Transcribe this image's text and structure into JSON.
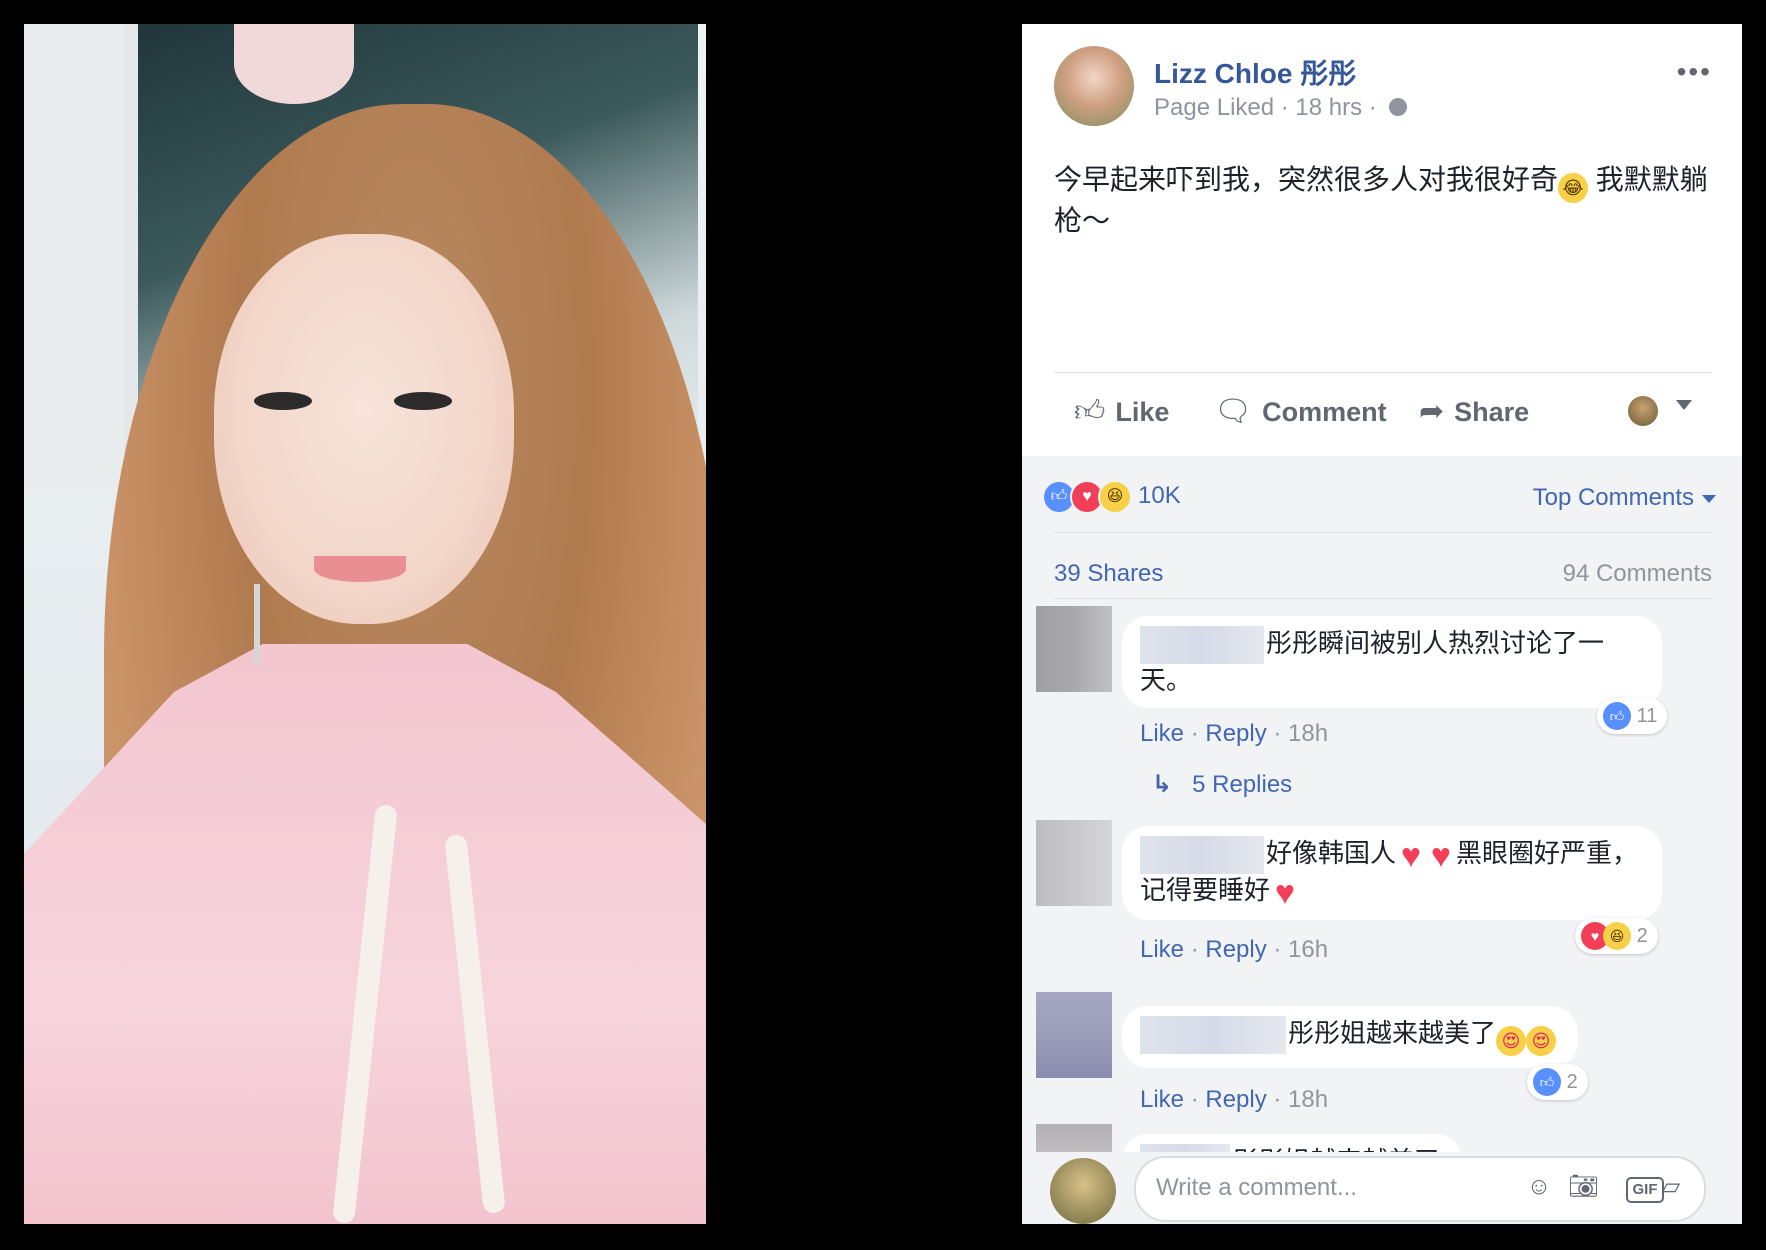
{
  "post": {
    "author": "Lizz Chloe 彤彤",
    "meta": "Page Liked · 18 hrs ·",
    "more": "•••",
    "text_part1": "今早起来吓到我，突然很多人对我很好奇",
    "text_part2": " 我默默躺枪～",
    "actions": {
      "like": "Like",
      "comment": "Comment",
      "share": "Share"
    },
    "reaction_count": "10K",
    "sort_label": "Top Comments",
    "shares": "39 Shares",
    "comments_count": "94 Comments"
  },
  "comments": [
    {
      "text": "彤彤瞬间被别人热烈讨论了一天。",
      "like": "Like",
      "reply": "Reply",
      "time": "18h",
      "reactions": "11"
    },
    {
      "text_a": "好像韩国人",
      "text_b": "黑眼圈好严重，记得要睡好",
      "like": "Like",
      "reply": "Reply",
      "time": "16h",
      "reactions": "2"
    },
    {
      "text": "彤彤姐越来越美了",
      "like": "Like",
      "reply": "Reply",
      "time": "18h",
      "reactions": "2"
    },
    {
      "text": "彤彤姐越来越美了"
    }
  ],
  "replies_label": "5 Replies",
  "composer": {
    "placeholder": "Write a comment..."
  },
  "colors": {
    "link": "#365899",
    "accent": "#4267b2",
    "muted": "#90949c"
  },
  "icons": [
    "thumbs-up-icon",
    "comment-icon",
    "share-icon",
    "emoji-icon",
    "camera-icon",
    "gif-icon",
    "sticker-icon",
    "globe-icon",
    "caret-down-icon",
    "reply-arrow-icon"
  ]
}
